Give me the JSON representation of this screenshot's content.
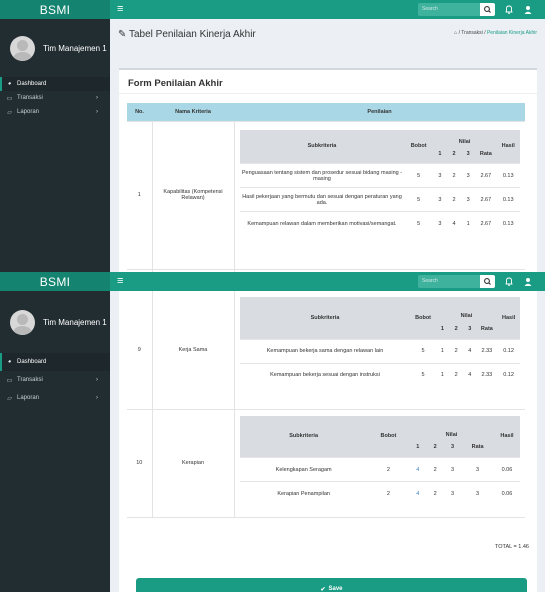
{
  "app": {
    "brand": "BSMI",
    "user_name": "Tim Manajemen 1"
  },
  "topbar": {
    "search_placeholder": "Search"
  },
  "sidebar": {
    "items": [
      {
        "label": "Dashboard",
        "icon": "dashboard-icon"
      },
      {
        "label": "Transaksi",
        "icon": "monitor-icon"
      },
      {
        "label": "Laporan",
        "icon": "folder-icon"
      }
    ]
  },
  "header": {
    "title": "Tabel Penilaian Kinerja Akhir",
    "breadcrumb_sep1": "/",
    "breadcrumb_parent": "Transaksi",
    "breadcrumb_sep2": "/",
    "breadcrumb_current": "Penilaian Kinerja Akhir"
  },
  "form": {
    "title": "Form Penilaian Akhir",
    "columns": {
      "no": "No.",
      "criteria": "Nama Kriteria",
      "assessment": "Penilaian"
    },
    "sub_columns": {
      "subcriteria": "Subkriteria",
      "weight": "Bobot",
      "score": "Nilai",
      "n1": "1",
      "n2": "2",
      "n3": "3",
      "avg": "Rata",
      "result": "Hasil"
    },
    "rows": [
      {
        "no": "1",
        "criteria": "Kapabilitas (Kompetensi Relawan)",
        "subs": [
          {
            "name": "Penguasaan tentang sistem dan prosedur sesuai bidang masing - masing",
            "weight": "5",
            "n1": "3",
            "n2": "2",
            "n3": "3",
            "avg": "2.67",
            "result": "0.13"
          },
          {
            "name": "Hasil pekerjaan yang bermutu dan sesuai dengan peraturan yang ada.",
            "weight": "5",
            "n1": "3",
            "n2": "2",
            "n3": "3",
            "avg": "2.67",
            "result": "0.13"
          },
          {
            "name": "Kemampuan relawan dalam memberikan motivasi/semangat.",
            "weight": "5",
            "n1": "3",
            "n2": "4",
            "n3": "1",
            "avg": "2.67",
            "result": "0.13"
          }
        ]
      },
      {
        "no": "9",
        "criteria": "Kerja Sama",
        "subs": [
          {
            "name": "Kemampuan bekerja sama dengan relawan lain",
            "weight": "5",
            "n1": "1",
            "n2": "2",
            "n3": "4",
            "avg": "2.33",
            "result": "0.12"
          },
          {
            "name": "Kemampuan bekerja sesuai dengan instruksi",
            "weight": "5",
            "n1": "1",
            "n2": "2",
            "n3": "4",
            "avg": "2.33",
            "result": "0.12"
          }
        ]
      },
      {
        "no": "10",
        "criteria": "Kerapian",
        "subs": [
          {
            "name": "Kelengkapan Seragam",
            "weight": "2",
            "n1": "4",
            "n2": "2",
            "n3": "3",
            "avg": "3",
            "result": "0.06"
          },
          {
            "name": "Kerapian Penampilan",
            "weight": "2",
            "n1": "4",
            "n2": "2",
            "n3": "3",
            "avg": "3",
            "result": "0.06"
          }
        ]
      }
    ],
    "total": "TOTAL = 1.46",
    "save_label": "Save"
  },
  "colors": {
    "brand": "#14836f",
    "accent": "#1a9b84",
    "sidebar": "#222d32",
    "header_row": "#aad7e6",
    "link_blue": "#3c7fc2"
  }
}
